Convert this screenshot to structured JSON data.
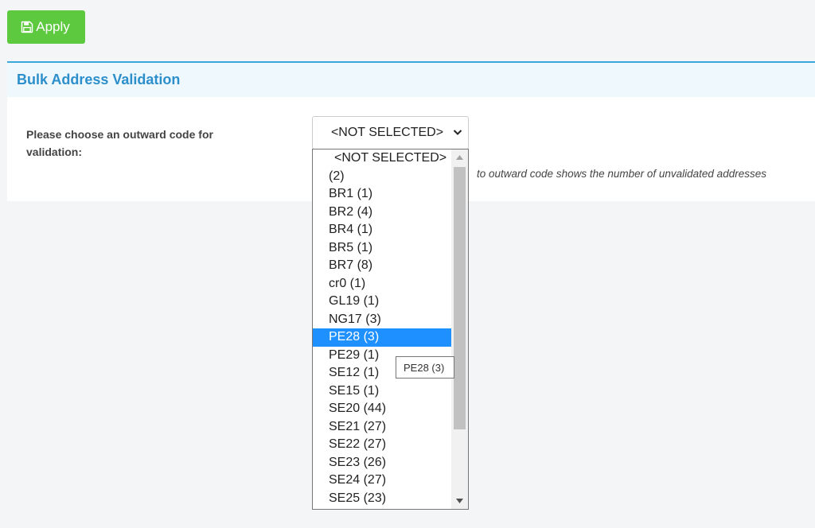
{
  "toolbar": {
    "apply_label": "Apply"
  },
  "panel": {
    "title": "Bulk Address Validation",
    "field_label": "Please choose an outward code for validation:",
    "hint": "to outward code shows the number of unvalidated addresses"
  },
  "select": {
    "value": "<NOT SELECTED>",
    "options": [
      "<NOT SELECTED>",
      "(2)",
      "BR1 (1)",
      "BR2 (4)",
      "BR4 (1)",
      "BR5 (1)",
      "BR7 (8)",
      "cr0 (1)",
      "GL19 (1)",
      "NG17 (3)",
      "PE28 (3)",
      "PE29 (1)",
      "SE12 (1)",
      "SE15 (1)",
      "SE20 (44)",
      "SE21 (27)",
      "SE22 (27)",
      "SE23 (26)",
      "SE24 (27)",
      "SE25 (23)"
    ],
    "highlighted": "PE28 (3)"
  },
  "tooltip": {
    "text": "PE28 (3)"
  },
  "colors": {
    "apply": "#5cc93f",
    "accent": "#2c8fcb",
    "highlight": "#1e90ff"
  },
  "icons": {
    "apply": "floppy-disk-icon",
    "select": "chevron-down-icon"
  }
}
